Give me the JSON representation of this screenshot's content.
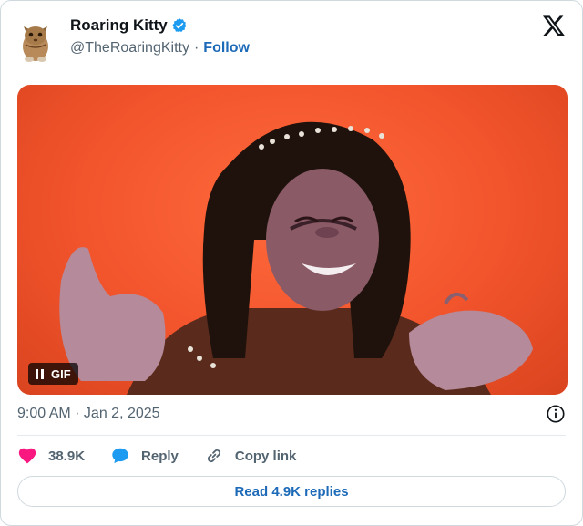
{
  "author": {
    "name": "Roaring Kitty",
    "handle": "@TheRoaringKitty",
    "separator": "·",
    "follow_label": "Follow",
    "verified": true,
    "avatar_icon": "kitten-avatar"
  },
  "platform_icon": "x-logo-icon",
  "media": {
    "badge_label": "GIF",
    "badge_icon": "pause-icon",
    "background_color": "#f2542c"
  },
  "timestamp": "9:00 AM · Jan 2, 2025",
  "actions": {
    "like_count": "38.9K",
    "reply_label": "Reply",
    "copy_label": "Copy link"
  },
  "read_replies_label": "Read 4.9K replies",
  "colors": {
    "link": "#1d6ab8",
    "like": "#f91880",
    "reply": "#1d9bf0",
    "verified": "#1d9bf0",
    "muted": "#536471"
  }
}
